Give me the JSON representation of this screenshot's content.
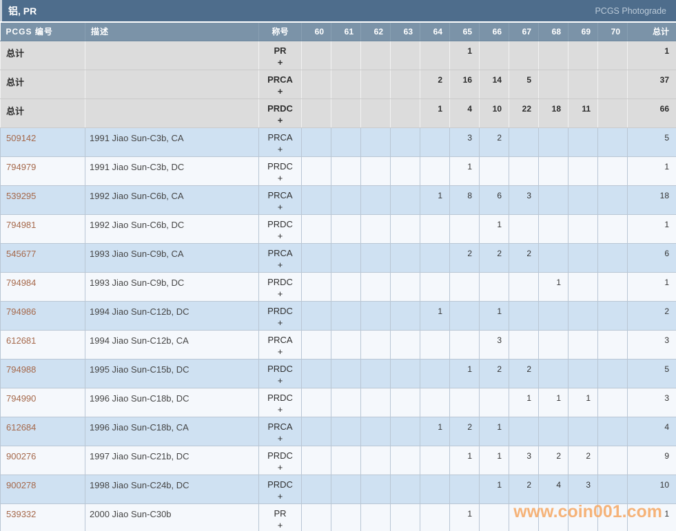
{
  "title_bar": {
    "title": "铝, PR",
    "right_label": "PCGS Photograde"
  },
  "table": {
    "columns": [
      "PCGS 编号",
      "描述",
      "称号",
      "60",
      "61",
      "62",
      "63",
      "64",
      "65",
      "66",
      "67",
      "68",
      "69",
      "70",
      "总计"
    ],
    "rows": [
      {
        "type": "summary",
        "pcgs": "总计",
        "desc": "",
        "designation": "PR",
        "plus": "+",
        "counts": [
          "",
          "",
          "",
          "",
          "",
          "1",
          "",
          "",
          "",
          "",
          ""
        ],
        "total": "1"
      },
      {
        "type": "summary",
        "pcgs": "总计",
        "desc": "",
        "designation": "PRCA",
        "plus": "+",
        "counts": [
          "",
          "",
          "",
          "",
          "2",
          "16",
          "14",
          "5",
          "",
          "",
          ""
        ],
        "total": "37"
      },
      {
        "type": "summary",
        "pcgs": "总计",
        "desc": "",
        "designation": "PRDC",
        "plus": "+",
        "counts": [
          "",
          "",
          "",
          "",
          "1",
          "4",
          "10",
          "22",
          "18",
          "11",
          ""
        ],
        "total": "66"
      },
      {
        "type": "coin",
        "pcgs": "509142",
        "desc": "1991 Jiao Sun-C3b, CA",
        "designation": "PRCA",
        "plus": "+",
        "counts": [
          "",
          "",
          "",
          "",
          "",
          "3",
          "2",
          "",
          "",
          "",
          ""
        ],
        "total": "5"
      },
      {
        "type": "coin",
        "pcgs": "794979",
        "desc": "1991 Jiao Sun-C3b, DC",
        "designation": "PRDC",
        "plus": "+",
        "counts": [
          "",
          "",
          "",
          "",
          "",
          "1",
          "",
          "",
          "",
          "",
          ""
        ],
        "total": "1"
      },
      {
        "type": "coin",
        "pcgs": "539295",
        "desc": "1992 Jiao Sun-C6b, CA",
        "designation": "PRCA",
        "plus": "+",
        "counts": [
          "",
          "",
          "",
          "",
          "1",
          "8",
          "6",
          "3",
          "",
          "",
          ""
        ],
        "total": "18"
      },
      {
        "type": "coin",
        "pcgs": "794981",
        "desc": "1992 Jiao Sun-C6b, DC",
        "designation": "PRDC",
        "plus": "+",
        "counts": [
          "",
          "",
          "",
          "",
          "",
          "",
          "1",
          "",
          "",
          "",
          ""
        ],
        "total": "1"
      },
      {
        "type": "coin",
        "pcgs": "545677",
        "desc": "1993 Jiao Sun-C9b, CA",
        "designation": "PRCA",
        "plus": "+",
        "counts": [
          "",
          "",
          "",
          "",
          "",
          "2",
          "2",
          "2",
          "",
          "",
          ""
        ],
        "total": "6"
      },
      {
        "type": "coin",
        "pcgs": "794984",
        "desc": "1993 Jiao Sun-C9b, DC",
        "designation": "PRDC",
        "plus": "+",
        "counts": [
          "",
          "",
          "",
          "",
          "",
          "",
          "",
          "",
          "1",
          "",
          ""
        ],
        "total": "1"
      },
      {
        "type": "coin",
        "pcgs": "794986",
        "desc": "1994 Jiao Sun-C12b, DC",
        "designation": "PRDC",
        "plus": "+",
        "counts": [
          "",
          "",
          "",
          "",
          "1",
          "",
          "1",
          "",
          "",
          "",
          ""
        ],
        "total": "2"
      },
      {
        "type": "coin",
        "pcgs": "612681",
        "desc": "1994 Jiao Sun-C12b, CA",
        "designation": "PRCA",
        "plus": "+",
        "counts": [
          "",
          "",
          "",
          "",
          "",
          "",
          "3",
          "",
          "",
          "",
          ""
        ],
        "total": "3"
      },
      {
        "type": "coin",
        "pcgs": "794988",
        "desc": "1995 Jiao Sun-C15b, DC",
        "designation": "PRDC",
        "plus": "+",
        "counts": [
          "",
          "",
          "",
          "",
          "",
          "1",
          "2",
          "2",
          "",
          "",
          ""
        ],
        "total": "5"
      },
      {
        "type": "coin",
        "pcgs": "794990",
        "desc": "1996 Jiao Sun-C18b, DC",
        "designation": "PRDC",
        "plus": "+",
        "counts": [
          "",
          "",
          "",
          "",
          "",
          "",
          "",
          "1",
          "1",
          "1",
          ""
        ],
        "total": "3"
      },
      {
        "type": "coin",
        "pcgs": "612684",
        "desc": "1996 Jiao Sun-C18b, CA",
        "designation": "PRCA",
        "plus": "+",
        "counts": [
          "",
          "",
          "",
          "",
          "1",
          "2",
          "1",
          "",
          "",
          "",
          ""
        ],
        "total": "4"
      },
      {
        "type": "coin",
        "pcgs": "900276",
        "desc": "1997 Jiao Sun-C21b, DC",
        "designation": "PRDC",
        "plus": "+",
        "counts": [
          "",
          "",
          "",
          "",
          "",
          "1",
          "1",
          "3",
          "2",
          "2",
          ""
        ],
        "total": "9"
      },
      {
        "type": "coin",
        "pcgs": "900278",
        "desc": "1998 Jiao Sun-C24b, DC",
        "designation": "PRDC",
        "plus": "+",
        "counts": [
          "",
          "",
          "",
          "",
          "",
          "",
          "1",
          "2",
          "4",
          "3",
          ""
        ],
        "total": "10"
      },
      {
        "type": "coin",
        "pcgs": "539332",
        "desc": "2000 Jiao Sun-C30b",
        "designation": "PR",
        "plus": "+",
        "counts": [
          "",
          "",
          "",
          "",
          "",
          "1",
          "",
          "",
          "",
          "",
          ""
        ],
        "total": "1"
      }
    ]
  },
  "watermark": "www.coin001.com",
  "colors": {
    "title_bar_bg": "#4e6d8c",
    "header_bg": "#7b93a8",
    "summary_row_bg": "#dcdcdc",
    "blue_row_bg": "#cfe1f2",
    "white_row_bg": "#f5f8fc",
    "pcgs_link": "#a5684a",
    "watermark_orange": "#f6a763"
  }
}
